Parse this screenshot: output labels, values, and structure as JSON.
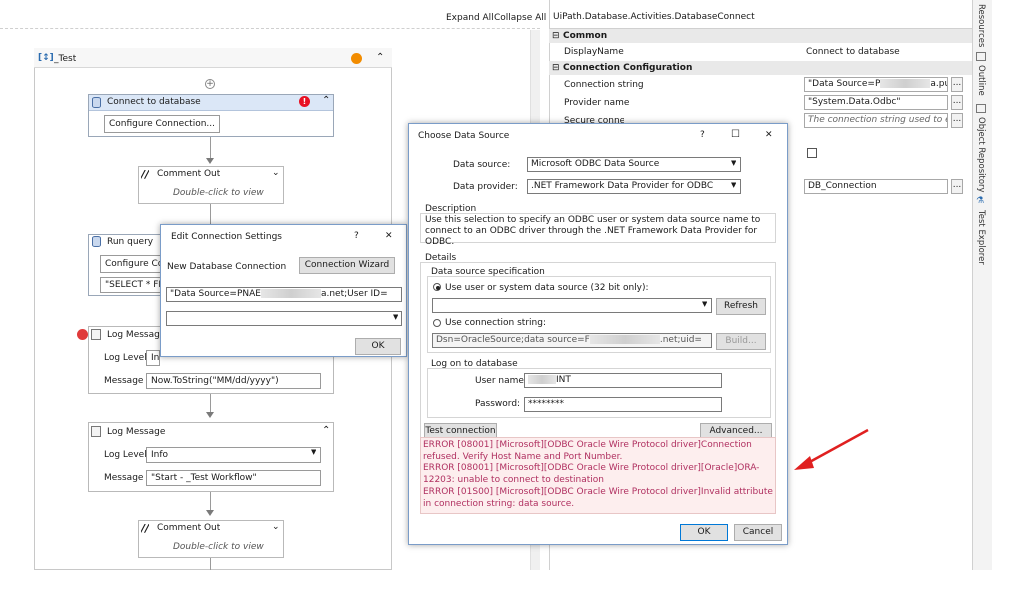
{
  "toolbar": {
    "expand_all": "Expand All",
    "collapse_all": "Collapse All"
  },
  "sequence": {
    "title": "_Test"
  },
  "activities": {
    "connect": {
      "title": "Connect to database",
      "button": "Configure Connection..."
    },
    "comment1": {
      "title": "Comment Out",
      "hint": "Double-click to view"
    },
    "run_query": {
      "title": "Run query",
      "button": "Configure Conn",
      "query": "\"SELECT * FRO"
    },
    "log1": {
      "title": "Log Message",
      "level_label": "Log Level",
      "level_value": "Info",
      "message_label": "Message",
      "message_value": "Now.ToString(\"MM/dd/yyyy\")"
    },
    "log2": {
      "title": "Log Message",
      "level_label": "Log Level",
      "level_value": "Info",
      "message_label": "Message",
      "message_value": "\"Start - _Test Workflow\""
    },
    "comment2": {
      "title": "Comment Out",
      "hint": "Double-click to view"
    }
  },
  "properties": {
    "header": "UiPath.Database.Activities.DatabaseConnect",
    "common": {
      "label": "Common",
      "display_name_label": "DisplayName",
      "display_name_value": "Connect to database"
    },
    "config": {
      "label": "Connection Configuration",
      "conn_string_label": "Connection string",
      "conn_string_value": "\"Data Source=P",
      "conn_string_tail": "a.pu",
      "provider_label": "Provider name",
      "provider_value": "\"System.Data.Odbc\"",
      "secure_label": "Secure connection string",
      "secure_placeholder": "The connection string used to establ",
      "output_value": "DB_Connection"
    }
  },
  "side_panel": {
    "tabs": [
      "Resources",
      "Outline",
      "Object Repository",
      "Test Explorer"
    ]
  },
  "edit_dialog": {
    "title": "Edit Connection Settings",
    "help": "?",
    "close": "✕",
    "new_label": "New Database Connection",
    "wizard_button": "Connection Wizard",
    "conn_value": "\"Data Source=PNAE",
    "conn_tail": "a.net;User ID=",
    "ok": "OK"
  },
  "ds_dialog": {
    "title": "Choose Data Source",
    "help": "?",
    "maximize": "☐",
    "close": "✕",
    "data_source_label": "Data source:",
    "data_source_value": "Microsoft ODBC Data Source",
    "provider_label": "Data provider:",
    "provider_value": ".NET Framework Data Provider for ODBC",
    "description_label": "Description",
    "description_text": "Use this selection to specify an ODBC user or system data source name to connect to an ODBC driver through the .NET Framework Data Provider for ODBC.",
    "details_label": "Details",
    "spec_label": "Data source specification",
    "radio_user": "Use user or system data source (32 bit only):",
    "refresh": "Refresh",
    "radio_conn": "Use connection string:",
    "conn_string_value": "Dsn=OracleSource;data source=F",
    "conn_string_tail": ".net;uid=",
    "build": "Build...",
    "logon_label": "Log on to database",
    "username_label": "User name:",
    "username_value": "INT",
    "password_label": "Password:",
    "password_value": "********",
    "test_button": "Test connection",
    "advanced_button": "Advanced...",
    "errors": [
      "ERROR [08001] [Microsoft][ODBC Oracle Wire Protocol driver]Connection refused. Verify Host Name and Port Number.",
      "ERROR [08001] [Microsoft][ODBC Oracle Wire Protocol driver][Oracle]ORA-12203: unable to connect to destination",
      "ERROR [01S00] [Microsoft][ODBC Oracle Wire Protocol driver]Invalid attribute in connection string: data source."
    ],
    "ok": "OK",
    "cancel": "Cancel"
  },
  "colors": {
    "accent": "#0078d7",
    "error_text": "#b03060",
    "arrow": "#e02020",
    "warning": "#e81123",
    "breakpoint": "#e03a3a"
  }
}
